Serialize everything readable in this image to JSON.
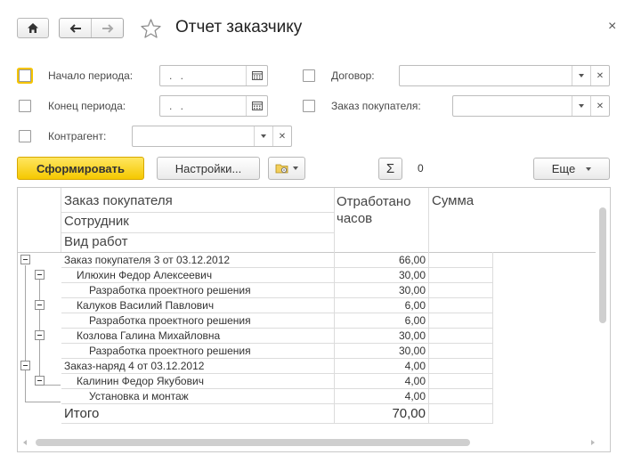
{
  "window": {
    "title": "Отчет заказчику",
    "close_glyph": "×"
  },
  "filters": {
    "period_start": {
      "label": "Начало периода:",
      "value": ". ."
    },
    "period_end": {
      "label": "Конец периода:",
      "value": ". ."
    },
    "contract": {
      "label": "Договор:",
      "value": ""
    },
    "customer_order": {
      "label": "Заказ покупателя:",
      "value": ""
    },
    "counterparty": {
      "label": "Контрагент:",
      "value": ""
    }
  },
  "toolbar": {
    "generate_label": "Сформировать",
    "settings_label": "Настройки...",
    "sum_glyph": "Σ",
    "sum_value": "0",
    "more_label": "Еще"
  },
  "report": {
    "headers": {
      "col1_line1": "Заказ покупателя",
      "col1_line2": "Сотрудник",
      "col1_line3": "Вид работ",
      "hours": "Отработано часов",
      "sum": "Сумма"
    },
    "rows": [
      {
        "level": 0,
        "name": "Заказ покупателя 3 от 03.12.2012",
        "hours": "66,00"
      },
      {
        "level": 1,
        "name": "Илюхин Федор Алексеевич",
        "hours": "30,00"
      },
      {
        "level": 2,
        "name": "Разработка проектного решения",
        "hours": "30,00"
      },
      {
        "level": 1,
        "name": "Калуков Василий Павлович",
        "hours": "6,00"
      },
      {
        "level": 2,
        "name": "Разработка проектного решения",
        "hours": "6,00"
      },
      {
        "level": 1,
        "name": "Козлова Галина Михайловна",
        "hours": "30,00"
      },
      {
        "level": 2,
        "name": "Разработка проектного решения",
        "hours": "30,00"
      },
      {
        "level": 0,
        "name": "Заказ-наряд 4 от 03.12.2012",
        "hours": "4,00"
      },
      {
        "level": 1,
        "name": "Калинин Федор Якубович",
        "hours": "4,00"
      },
      {
        "level": 2,
        "name": "Установка и монтаж",
        "hours": "4,00"
      }
    ],
    "total_label": "Итого",
    "total_hours": "70,00"
  },
  "colors": {
    "accent_yellow": "#f5c800",
    "focus_ring": "#f5c400"
  }
}
